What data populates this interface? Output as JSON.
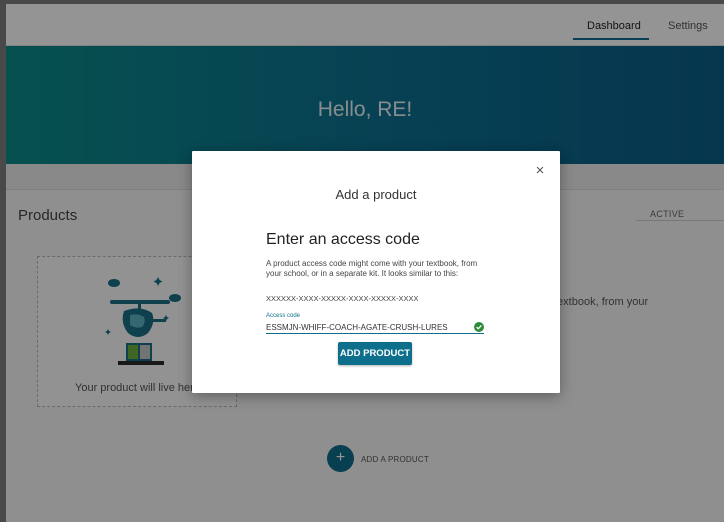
{
  "nav": {
    "tabs": [
      {
        "label": "Dashboard",
        "active": true
      },
      {
        "label": "Settings",
        "active": false
      }
    ]
  },
  "hero": {
    "greeting": "Hello, RE!"
  },
  "products": {
    "title": "Products",
    "filter_label": "ACTIVE",
    "placeholder_text": "Your product will live here",
    "right_text": "textbook, from your",
    "add_label": "ADD A PRODUCT",
    "add_icon": "+"
  },
  "modal": {
    "title": "Add a product",
    "close_icon": "×",
    "heading": "Enter an access code",
    "description": "A product access code might come with your textbook, from your school, or in a separate kit. It looks similar to this:",
    "sample_code": "XXXXXX-XXXX-XXXXX-XXXX-XXXXX-XXXX",
    "field_label": "Access code",
    "field_value": "ESSMJN-WHIFF-COACH-AGATE-CRUSH-LURES",
    "button_label": "ADD PRODUCT"
  },
  "colors": {
    "accent": "#0e6f8c",
    "valid": "#2e8b3a",
    "hero_start": "#0b8c8a",
    "hero_end": "#0a5e86"
  }
}
